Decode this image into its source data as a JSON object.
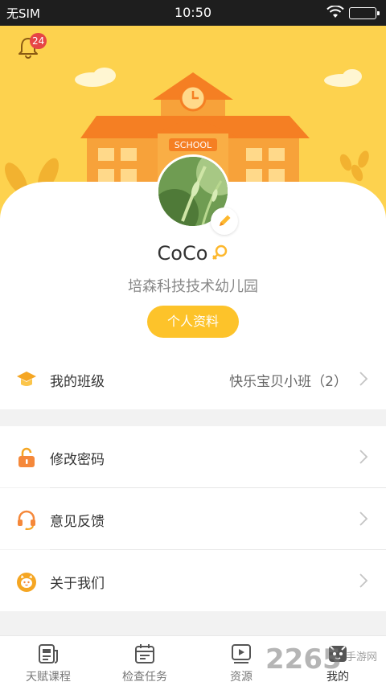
{
  "status_bar": {
    "carrier": "无SIM",
    "time": "10:50"
  },
  "header": {
    "notification_count": "24",
    "school_sign": "SCHOOL"
  },
  "profile": {
    "username": "CoCo",
    "school": "培森科技技术幼儿园",
    "profile_button": "个人资料"
  },
  "menu": {
    "class": {
      "label": "我的班级",
      "value": "快乐宝贝小班（2）"
    },
    "change_password": {
      "label": "修改密码"
    },
    "feedback": {
      "label": "意见反馈"
    },
    "about": {
      "label": "关于我们"
    }
  },
  "tabbar": {
    "tabs": [
      {
        "label": "天赋课程",
        "icon": "course-icon"
      },
      {
        "label": "检查任务",
        "icon": "calendar-icon"
      },
      {
        "label": "资源",
        "icon": "video-icon"
      },
      {
        "label": "我的",
        "icon": "profile-icon"
      }
    ],
    "active_index": 3
  },
  "watermark": {
    "text": "2265",
    "site": "手游网"
  },
  "colors": {
    "accent": "#fdc32a",
    "header_bg": "#fdd24e",
    "badge": "#e64545",
    "school_building": "#f7a23a",
    "roof": "#f57f23"
  }
}
